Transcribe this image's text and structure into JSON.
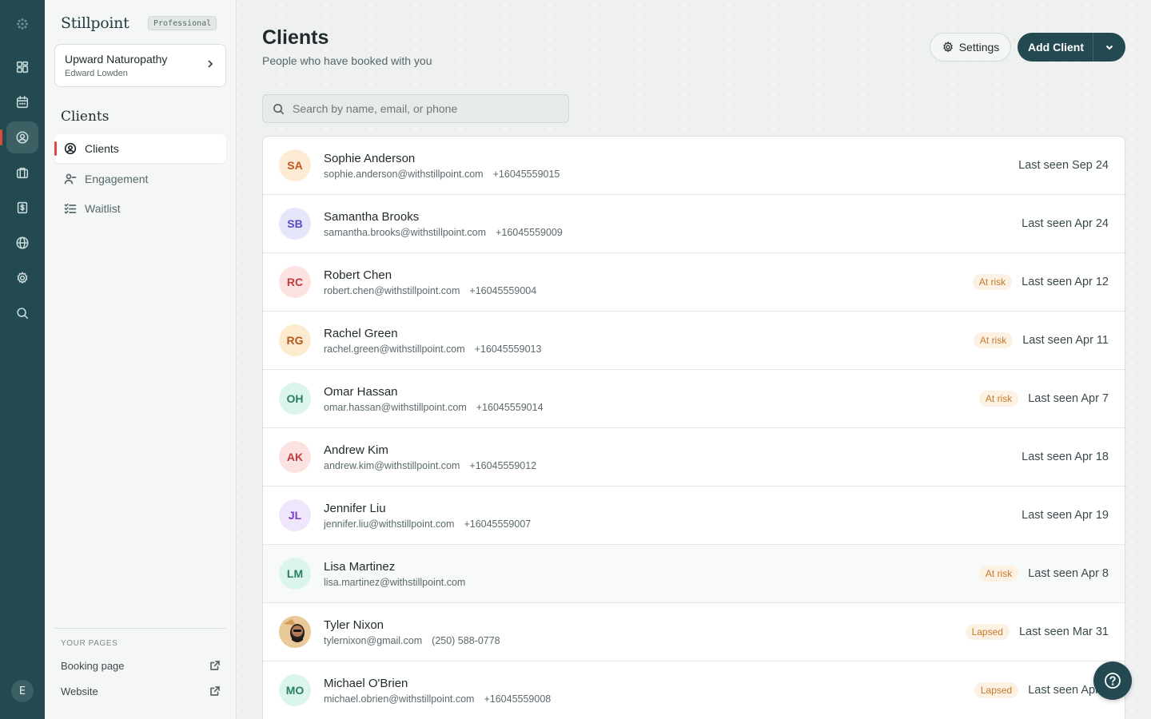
{
  "app": {
    "brand": "Stillpoint",
    "plan_badge": "Professional",
    "user_initial": "E"
  },
  "practice": {
    "name": "Upward Naturopathy",
    "owner": "Edward Lowden"
  },
  "sidebar": {
    "section_title": "Clients",
    "items": [
      {
        "label": "Clients",
        "icon": "user-circle-icon",
        "active": true
      },
      {
        "label": "Engagement",
        "icon": "user-minus-icon",
        "active": false
      },
      {
        "label": "Waitlist",
        "icon": "list-check-icon",
        "active": false
      }
    ],
    "pages_label": "YOUR PAGES",
    "pages": [
      {
        "label": "Booking page",
        "icon": "external-link-icon"
      },
      {
        "label": "Website",
        "icon": "external-link-icon"
      }
    ]
  },
  "rail": {
    "items": [
      "dashboard-icon",
      "calendar-icon",
      "clients-icon",
      "briefcase-icon",
      "invoice-icon",
      "globe-icon",
      "gear-icon",
      "search-icon"
    ]
  },
  "header": {
    "title": "Clients",
    "subtitle": "People who have booked with you",
    "settings_label": "Settings",
    "add_label": "Add Client"
  },
  "search": {
    "placeholder": "Search by name, email, or phone",
    "value": ""
  },
  "clients": [
    {
      "initials": "SA",
      "name": "Sophie Anderson",
      "email": "sophie.anderson@withstillpoint.com",
      "phone": "+16045559015",
      "badge": "",
      "last_seen": "Last seen Sep 24",
      "avatar_bg": "#fdebd6",
      "avatar_fg": "#c2551f"
    },
    {
      "initials": "SB",
      "name": "Samantha Brooks",
      "email": "samantha.brooks@withstillpoint.com",
      "phone": "+16045559009",
      "badge": "",
      "last_seen": "Last seen Apr 24",
      "avatar_bg": "#e6e6fb",
      "avatar_fg": "#5b4bc4"
    },
    {
      "initials": "RC",
      "name": "Robert Chen",
      "email": "robert.chen@withstillpoint.com",
      "phone": "+16045559004",
      "badge": "At risk",
      "last_seen": "Last seen Apr 12",
      "avatar_bg": "#fde2e2",
      "avatar_fg": "#c43a3a"
    },
    {
      "initials": "RG",
      "name": "Rachel Green",
      "email": "rachel.green@withstillpoint.com",
      "phone": "+16045559013",
      "badge": "At risk",
      "last_seen": "Last seen Apr 11",
      "avatar_bg": "#fdebd0",
      "avatar_fg": "#b5581c"
    },
    {
      "initials": "OH",
      "name": "Omar Hassan",
      "email": "omar.hassan@withstillpoint.com",
      "phone": "+16045559014",
      "badge": "At risk",
      "last_seen": "Last seen Apr 7",
      "avatar_bg": "#dcf5ec",
      "avatar_fg": "#2a7f62"
    },
    {
      "initials": "AK",
      "name": "Andrew Kim",
      "email": "andrew.kim@withstillpoint.com",
      "phone": "+16045559012",
      "badge": "",
      "last_seen": "Last seen Apr 18",
      "avatar_bg": "#fde2e2",
      "avatar_fg": "#c43a3a"
    },
    {
      "initials": "JL",
      "name": "Jennifer Liu",
      "email": "jennifer.liu@withstillpoint.com",
      "phone": "+16045559007",
      "badge": "",
      "last_seen": "Last seen Apr 19",
      "avatar_bg": "#efe6fb",
      "avatar_fg": "#7a3fc2"
    },
    {
      "initials": "LM",
      "name": "Lisa Martinez",
      "email": "lisa.martinez@withstillpoint.com",
      "phone": "",
      "badge": "At risk",
      "last_seen": "Last seen Apr 8",
      "avatar_bg": "#dcf5ec",
      "avatar_fg": "#2a7f62"
    },
    {
      "initials": "",
      "name": "Tyler Nixon",
      "email": "tylernixon@gmail.com",
      "phone": "(250) 588-0778",
      "badge": "Lapsed",
      "last_seen": "Last seen Mar 31",
      "avatar_bg": "#f3e3c8",
      "avatar_fg": "#333333",
      "photo": true
    },
    {
      "initials": "MO",
      "name": "Michael O'Brien",
      "email": "michael.obrien@withstillpoint.com",
      "phone": "+16045559008",
      "badge": "Lapsed",
      "last_seen": "Last seen Apr 5",
      "avatar_bg": "#dcf5ec",
      "avatar_fg": "#2a7f62"
    }
  ]
}
